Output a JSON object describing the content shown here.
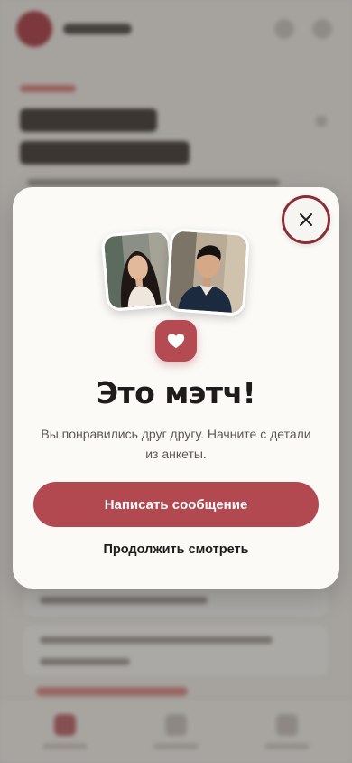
{
  "match_modal": {
    "title": "Это мэтч!",
    "subtitle": "Вы понравились друг другу. Начните с детали из анкеты.",
    "primary_button": "Написать сообщение",
    "secondary_button": "Продолжить смотреть",
    "close_icon": "close-icon",
    "heart_icon": "heart-icon"
  },
  "colors": {
    "accent": "#b34950",
    "close_ring": "#8a2e36",
    "modal_bg": "#fbfaf7",
    "title": "#1e1b1a"
  }
}
